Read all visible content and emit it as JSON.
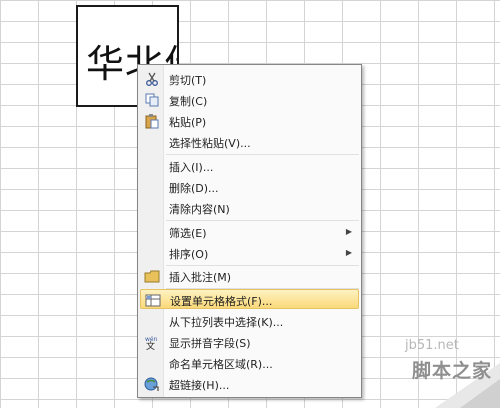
{
  "cell": {
    "text": "华北佳"
  },
  "context_menu": {
    "items": [
      {
        "label": "剪切(T)",
        "icon": "scissors-icon"
      },
      {
        "label": "复制(C)",
        "icon": "copy-icon"
      },
      {
        "label": "粘贴(P)",
        "icon": "paste-icon"
      },
      {
        "label": "选择性粘贴(V)..."
      },
      {
        "label": "插入(I)..."
      },
      {
        "label": "删除(D)..."
      },
      {
        "label": "清除内容(N)"
      },
      {
        "label": "筛选(E)",
        "submenu": true
      },
      {
        "label": "排序(O)",
        "submenu": true
      },
      {
        "label": "插入批注(M)",
        "icon": "comment-icon"
      },
      {
        "label": "设置单元格格式(F)...",
        "icon": "format-cells-icon",
        "highlighted": true
      },
      {
        "label": "从下拉列表中选择(K)..."
      },
      {
        "label": "显示拼音字段(S)",
        "icon": "phonetic-icon"
      },
      {
        "label": "命名单元格区域(R)..."
      },
      {
        "label": "超链接(H)...",
        "icon": "hyperlink-icon"
      }
    ]
  },
  "watermark": {
    "url": "jb51.net",
    "brand": "脚本之家"
  },
  "colors": {
    "highlight": "#fbd97a",
    "menu_bg": "#fafafa",
    "grid": "#d4d4d4"
  }
}
